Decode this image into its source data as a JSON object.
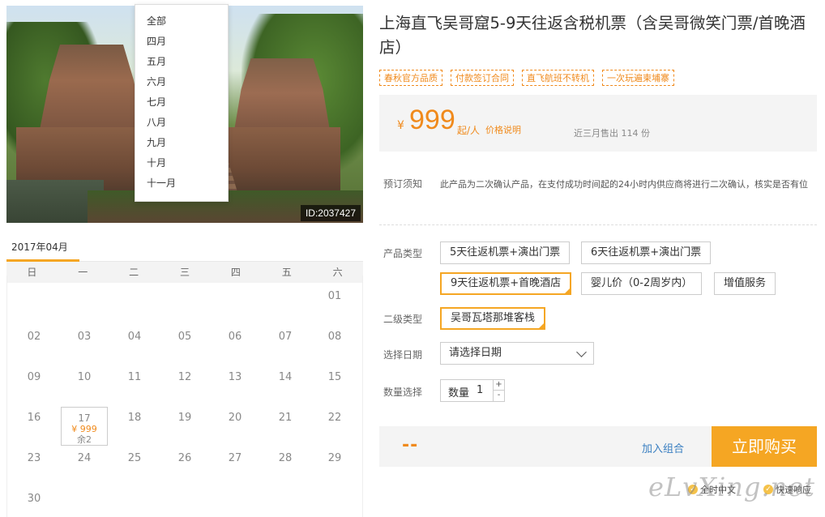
{
  "photo": {
    "id_label": "ID:2037427"
  },
  "month_dropdown": {
    "options": [
      "全部",
      "四月",
      "五月",
      "六月",
      "七月",
      "八月",
      "九月",
      "十月",
      "十一月"
    ]
  },
  "calendar": {
    "month_label": "2017年04月",
    "weekdays": [
      "日",
      "一",
      "二",
      "三",
      "四",
      "五",
      "六"
    ],
    "days": {
      "d01": "01",
      "d02": "02",
      "d03": "03",
      "d04": "04",
      "d05": "05",
      "d06": "06",
      "d07": "07",
      "d08": "08",
      "d09": "09",
      "d10": "10",
      "d11": "11",
      "d12": "12",
      "d13": "13",
      "d14": "14",
      "d15": "15",
      "d16": "16",
      "d17": "17",
      "d18": "18",
      "d19": "19",
      "d20": "20",
      "d21": "21",
      "d22": "22",
      "d23": "23",
      "d24": "24",
      "d25": "25",
      "d26": "26",
      "d27": "27",
      "d28": "28",
      "d29": "29",
      "d30": "30"
    },
    "available": {
      "price": "¥ 999",
      "remaining": "余2"
    }
  },
  "product": {
    "title": "上海直飞吴哥窟5-9天往返含税机票（含吴哥微笑门票/首晚酒店）",
    "tags": [
      "春秋官方品质",
      "付款签订合同",
      "直飞航班不转机",
      "一次玩遍柬埔寨"
    ],
    "price": {
      "currency": "¥",
      "amount": "999",
      "unit": "起/人",
      "explain_link": "价格说明",
      "sold": "近三月售出 114 份"
    },
    "notice": {
      "label": "预订须知",
      "text": "此产品为二次确认产品，在支付成功时间起的24小时内供应商将进行二次确认，核实是否有位"
    },
    "product_type": {
      "label": "产品类型",
      "options": [
        "5天往返机票+演出门票",
        "6天往返机票+演出门票",
        "9天往返机票+首晚酒店",
        "婴儿价（0-2周岁内）",
        "增值服务"
      ]
    },
    "sub_type": {
      "label": "二级类型",
      "option": "吴哥瓦塔那堆客栈"
    },
    "date": {
      "label": "选择日期",
      "placeholder": "请选择日期"
    },
    "quantity": {
      "label": "数量选择",
      "field_label": "数量",
      "value": "1",
      "plus": "+",
      "minus": "-"
    }
  },
  "buy_bar": {
    "total": "--",
    "combo_link": "加入组合",
    "buy_button": "立即购买"
  },
  "footer": {
    "badge_1": "全时中文",
    "badge_2": "快速响应"
  },
  "colors": {
    "accent": "#f5a623",
    "price": "#f08a1c",
    "link": "#3a7fc1"
  }
}
